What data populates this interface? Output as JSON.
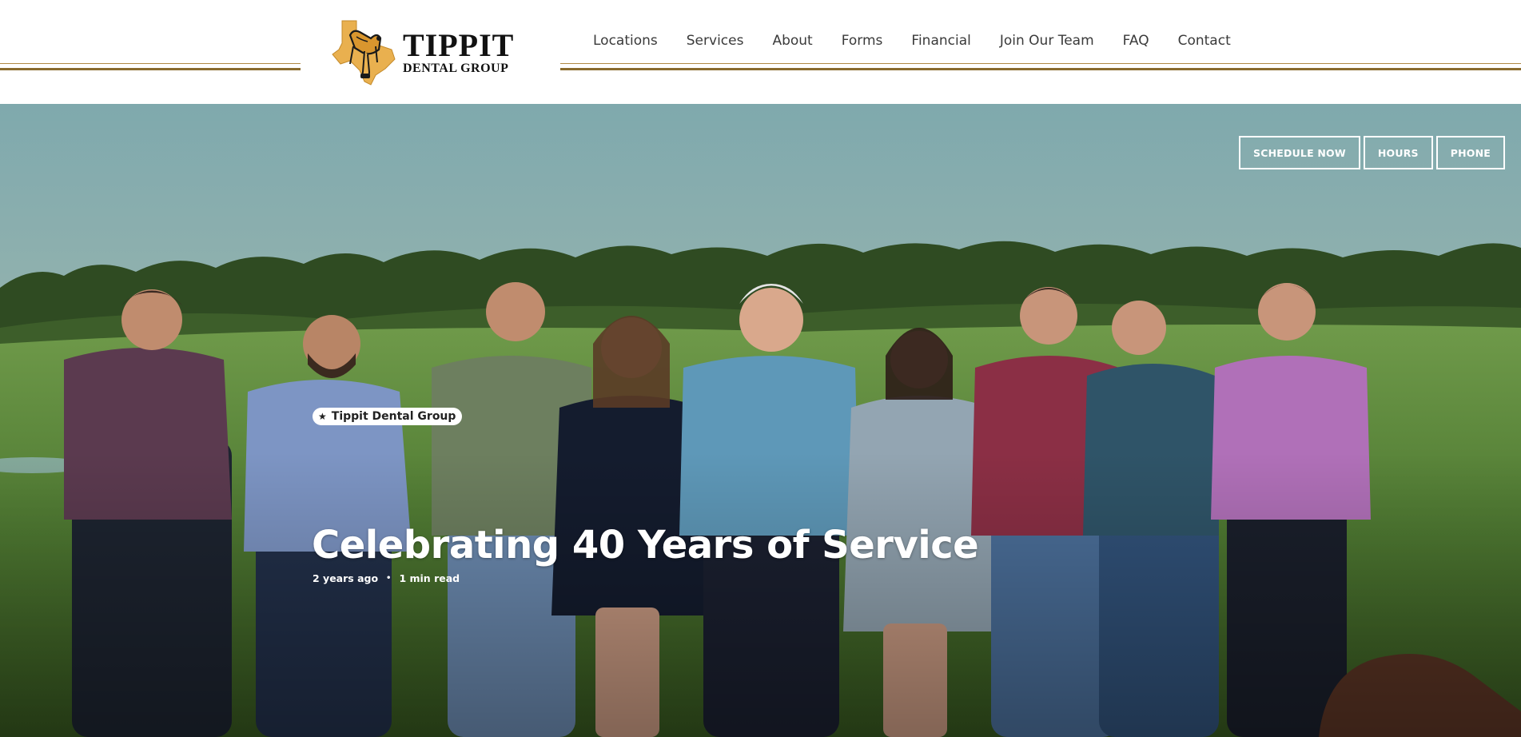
{
  "header": {
    "logo": {
      "name": "TIPPIT",
      "subtitle": "DENTAL GROUP",
      "icon": "saddle-texas-icon"
    },
    "nav": [
      {
        "label": "Locations"
      },
      {
        "label": "Services"
      },
      {
        "label": "About"
      },
      {
        "label": "Forms"
      },
      {
        "label": "Financial"
      },
      {
        "label": "Join Our Team"
      },
      {
        "label": "FAQ"
      },
      {
        "label": "Contact"
      }
    ]
  },
  "hero": {
    "ctas": {
      "schedule": "SCHEDULE NOW",
      "hours": "HOURS",
      "phone": "PHONE"
    },
    "category_badge": {
      "icon": "star-icon",
      "label": "Tippit Dental Group"
    },
    "post": {
      "title": "Celebrating 40 Years of Service",
      "age": "2 years ago",
      "read_time": "1 min read"
    }
  },
  "colors": {
    "accent_gold": "#b08a45",
    "accent_gold_dark": "#8a6b2e",
    "logo_saddle": "#e9b04f",
    "nav_text": "#3a3a3a"
  }
}
